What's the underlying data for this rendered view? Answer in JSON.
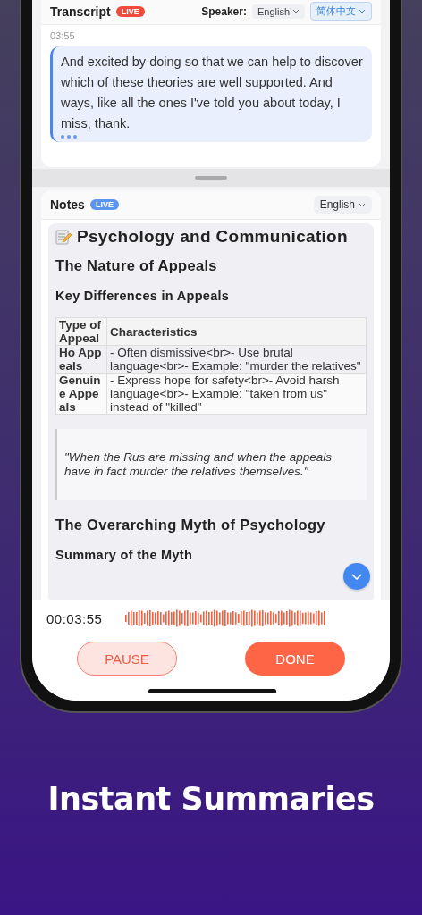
{
  "transcript": {
    "title": "Transcript",
    "badge": "LIVE",
    "speaker_label": "Speaker:",
    "speaker_language": "English",
    "translation_language": "简体中文",
    "entries": [
      {
        "time": "03:55",
        "text": "And excited by doing so that we can help to discover which of these theories are well supported. And ways, like all the ones I've told you about today, I miss, thank.",
        "typing": true
      }
    ]
  },
  "notes": {
    "title": "Notes",
    "badge": "LIVE",
    "language": "English",
    "content": [
      {
        "kind": "h1",
        "text": "Psychology and Communication"
      },
      {
        "kind": "h2",
        "text": "The Nature of Appeals"
      },
      {
        "kind": "h3",
        "text": "Key Differences in Appeals"
      },
      {
        "kind": "table",
        "columns": [
          "Type of Appeal",
          "Characteristics"
        ],
        "rows": [
          [
            "Ho Appeals",
            "- Often dismissive<br>- Use brutal language<br>- Example: \"murder the relatives\""
          ],
          [
            "Genuine Appeals",
            "- Express hope for safety<br>- Avoid harsh language<br>- Example: \"taken from us\" instead of \"killed\""
          ]
        ]
      },
      {
        "kind": "quote",
        "text": "\"When the Rus are missing and when the appeals have in fact murder the relatives themselves.\""
      },
      {
        "kind": "h2",
        "text": "The Overarching Myth of Psychology"
      },
      {
        "kind": "h3",
        "text": "Summary of the Myth"
      }
    ]
  },
  "recorder": {
    "elapsed": "00:03:55",
    "buttons": [
      {
        "label": "PAUSE",
        "kind": "secondary"
      },
      {
        "label": "DONE",
        "kind": "primary"
      }
    ]
  },
  "caption": "Instant Summaries"
}
